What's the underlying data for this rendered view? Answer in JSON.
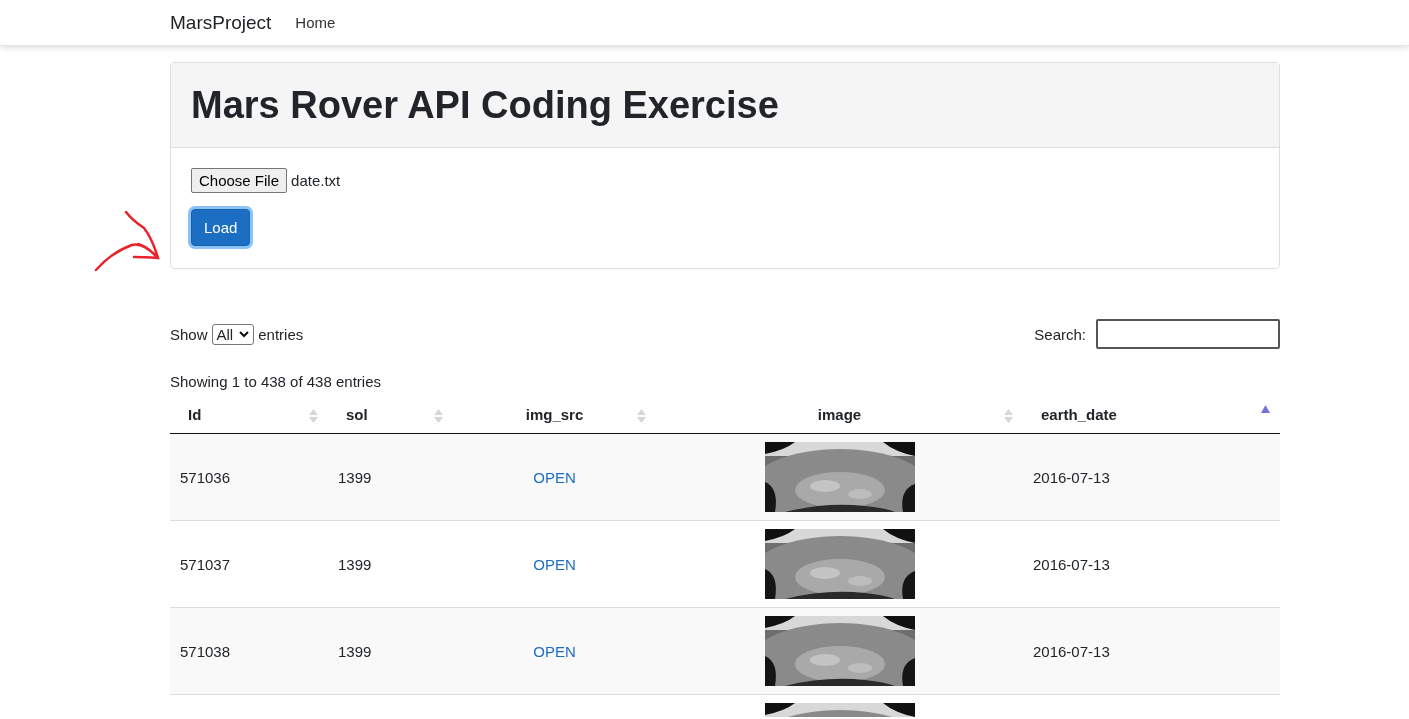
{
  "navbar": {
    "brand": "MarsProject",
    "links": [
      {
        "label": "Home"
      }
    ]
  },
  "card": {
    "title": "Mars Rover API Coding Exercise",
    "file_button": "Choose File",
    "file_name": "date.txt",
    "load_button": {
      "label": "Load",
      "focused": true
    }
  },
  "annotation": {
    "kind": "arrow"
  },
  "table_controls": {
    "show_label": "Show",
    "page_size": "All",
    "entries_label": "entries",
    "search_label": "Search:",
    "info": "Showing 1 to 438 of 438 entries"
  },
  "table": {
    "columns": [
      {
        "label": "Id",
        "sorted": false
      },
      {
        "label": "sol",
        "sorted": false
      },
      {
        "label": "img_src",
        "sorted": false
      },
      {
        "label": "image",
        "sorted": false
      },
      {
        "label": "earth_date",
        "sorted": true
      }
    ],
    "rows": [
      {
        "id": "571036",
        "sol": "1399",
        "link": "OPEN",
        "earth_date": "2016-07-13"
      },
      {
        "id": "571037",
        "sol": "1399",
        "link": "OPEN",
        "earth_date": "2016-07-13"
      },
      {
        "id": "571038",
        "sol": "1399",
        "link": "OPEN",
        "earth_date": "2016-07-13"
      }
    ]
  }
}
